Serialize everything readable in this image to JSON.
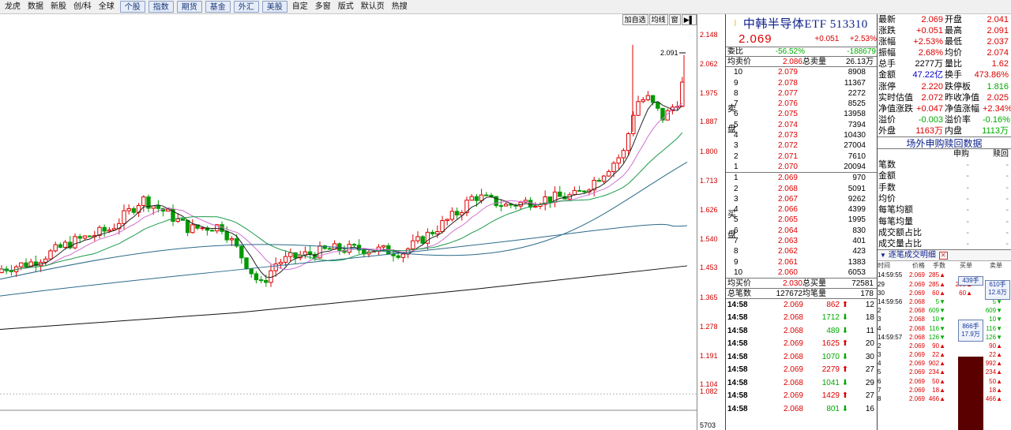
{
  "toolbar": {
    "items": [
      {
        "label": "龙虎",
        "boxed": false
      },
      {
        "label": "数据",
        "boxed": false
      },
      {
        "label": "新股",
        "boxed": false
      },
      {
        "label": "创/科",
        "boxed": false
      },
      {
        "label": "全球",
        "boxed": false
      },
      {
        "label": "个股",
        "boxed": true
      },
      {
        "label": "指数",
        "boxed": true
      },
      {
        "label": "期货",
        "boxed": true
      },
      {
        "label": "基金",
        "boxed": true
      },
      {
        "label": "外汇",
        "boxed": true
      },
      {
        "label": "美股",
        "boxed": true
      },
      {
        "label": "自定",
        "boxed": false
      },
      {
        "label": "多窗",
        "boxed": false
      },
      {
        "label": "版式",
        "boxed": false
      },
      {
        "label": "默认页",
        "boxed": false
      },
      {
        "label": "热搜",
        "boxed": false
      }
    ]
  },
  "chart": {
    "buttons": [
      "加自选",
      "均线",
      "窗",
      "▶▌"
    ],
    "price_marker": "2.091",
    "y_labels": [
      "2.148",
      "2.062",
      "1.975",
      "1.887",
      "1.800",
      "1.713",
      "1.626",
      "1.540",
      "1.453",
      "1.365",
      "1.278",
      "1.191",
      "1.104",
      "1.082",
      "5703"
    ],
    "colors": {
      "up": "#dd0000",
      "down": "#009900",
      "ma5": "#222222",
      "ma10": "#d070d0",
      "ma20": "#1a9a4a",
      "ma60": "#2a6a8a",
      "ma120": "#111111"
    }
  },
  "quote": {
    "name": "中韩半导体ETF 513310",
    "price": "2.069",
    "change": "+0.051",
    "change_pct": "+2.53%",
    "weibi_label": "委比",
    "weibi_pct": "-56.52%",
    "weibi_diff": "-188679",
    "avg_sell_label": "均卖价",
    "avg_sell": "2.086",
    "total_sell_label": "总卖量",
    "total_sell": "26.13万",
    "sell_side_label": "卖盘",
    "buy_side_label": "买盘",
    "asks": [
      {
        "n": "10",
        "price": "2.079",
        "vol": "8908"
      },
      {
        "n": "9",
        "price": "2.078",
        "vol": "11367"
      },
      {
        "n": "8",
        "price": "2.077",
        "vol": "2272"
      },
      {
        "n": "7",
        "price": "2.076",
        "vol": "8525"
      },
      {
        "n": "6",
        "price": "2.075",
        "vol": "13958"
      },
      {
        "n": "5",
        "price": "2.074",
        "vol": "7394"
      },
      {
        "n": "4",
        "price": "2.073",
        "vol": "10430"
      },
      {
        "n": "3",
        "price": "2.072",
        "vol": "27004"
      },
      {
        "n": "2",
        "price": "2.071",
        "vol": "7610"
      },
      {
        "n": "1",
        "price": "2.070",
        "vol": "20094"
      }
    ],
    "bids": [
      {
        "n": "1",
        "price": "2.069",
        "vol": "970"
      },
      {
        "n": "2",
        "price": "2.068",
        "vol": "5091"
      },
      {
        "n": "3",
        "price": "2.067",
        "vol": "9262"
      },
      {
        "n": "4",
        "price": "2.066",
        "vol": "4399"
      },
      {
        "n": "5",
        "price": "2.065",
        "vol": "1995"
      },
      {
        "n": "6",
        "price": "2.064",
        "vol": "830"
      },
      {
        "n": "7",
        "price": "2.063",
        "vol": "401"
      },
      {
        "n": "8",
        "price": "2.062",
        "vol": "423"
      },
      {
        "n": "9",
        "price": "2.061",
        "vol": "1383"
      },
      {
        "n": "10",
        "price": "2.060",
        "vol": "6053"
      }
    ],
    "avg_buy_label": "均买价",
    "avg_buy": "2.030",
    "total_buy_label": "总买量",
    "total_buy": "72581",
    "total_count_label": "总笔数",
    "total_count": "127672",
    "avg_count_label": "均笔量",
    "avg_count": "178",
    "trades": [
      {
        "time": "14:58",
        "price": "2.069",
        "vol": "862",
        "dir": "up",
        "n": "12"
      },
      {
        "time": "14:58",
        "price": "2.068",
        "vol": "1712",
        "dir": "down",
        "n": "18"
      },
      {
        "time": "14:58",
        "price": "2.068",
        "vol": "489",
        "dir": "down",
        "n": "11"
      },
      {
        "time": "14:58",
        "price": "2.069",
        "vol": "1625",
        "dir": "up",
        "n": "20"
      },
      {
        "time": "14:58",
        "price": "2.068",
        "vol": "1070",
        "dir": "down",
        "n": "30"
      },
      {
        "time": "14:58",
        "price": "2.069",
        "vol": "2279",
        "dir": "up",
        "n": "27"
      },
      {
        "time": "14:58",
        "price": "2.068",
        "vol": "1041",
        "dir": "down",
        "n": "29"
      },
      {
        "time": "14:58",
        "price": "2.069",
        "vol": "1429",
        "dir": "up",
        "n": "27"
      },
      {
        "time": "14:58",
        "price": "2.068",
        "vol": "801",
        "dir": "down",
        "n": "16"
      }
    ]
  },
  "stats": {
    "rows": [
      {
        "k1": "最新",
        "v1": "2.069",
        "k2": "开盘",
        "v2": "2.041",
        "c1": "red",
        "c2": "red"
      },
      {
        "k1": "涨跌",
        "v1": "+0.051",
        "k2": "最高",
        "v2": "2.091",
        "c1": "red",
        "c2": "red"
      },
      {
        "k1": "涨幅",
        "v1": "+2.53%",
        "k2": "最低",
        "v2": "2.037",
        "c1": "red",
        "c2": "red"
      },
      {
        "k1": "振幅",
        "v1": "2.68%",
        "k2": "均价",
        "v2": "2.074",
        "c1": "red",
        "c2": "red"
      },
      {
        "k1": "总手",
        "v1": "2277万",
        "k2": "量比",
        "v2": "1.62",
        "c1": "black",
        "c2": "red"
      },
      {
        "k1": "金额",
        "v1": "47.22亿",
        "k2": "换手",
        "v2": "473.86%",
        "c1": "blue",
        "c2": "red"
      },
      {
        "k1": "涨停",
        "v1": "2.220",
        "k2": "跌停板",
        "v2": "1.816",
        "c1": "red",
        "c2": "green"
      },
      {
        "k1": "实时估值",
        "v1": "2.072",
        "k2": "昨收净值",
        "v2": "2.025",
        "c1": "red",
        "c2": "red"
      },
      {
        "k1": "净值涨跌",
        "v1": "+0.047",
        "k2": "净值涨幅",
        "v2": "+2.34%",
        "c1": "red",
        "c2": "red"
      },
      {
        "k1": "溢价",
        "v1": "-0.003",
        "k2": "溢价率",
        "v2": "-0.16%",
        "c1": "green",
        "c2": "green"
      },
      {
        "k1": "外盘",
        "v1": "1163万",
        "k2": "内盘",
        "v2": "1113万",
        "c1": "red",
        "c2": "green"
      }
    ],
    "offmarket_title": "场外申购赎回数据",
    "sub_buy": "申购",
    "sub_sell": "赎回",
    "offmarket_rows": [
      {
        "k": "笔数",
        "a": "-",
        "b": "-"
      },
      {
        "k": "金额",
        "a": "-",
        "b": "-"
      },
      {
        "k": "手数",
        "a": "-",
        "b": "-"
      },
      {
        "k": "均价",
        "a": "-",
        "b": "-"
      },
      {
        "k": "每笔均额",
        "a": "-",
        "b": "-"
      },
      {
        "k": "每笔均量",
        "a": "-",
        "b": "-"
      },
      {
        "k": "成交额占比",
        "a": "-",
        "b": "-"
      },
      {
        "k": "成交量占比",
        "a": "-",
        "b": "-"
      }
    ],
    "detail_title": "逐笔成交明细",
    "detail_headers": [
      "时间",
      "价格",
      "手数",
      "买单",
      "卖单"
    ],
    "detail_rows": [
      {
        "t": "14:59:55",
        "p": "2.069",
        "q": "285▲",
        "buy": "",
        "sell": ""
      },
      {
        "t": "29",
        "p": "2.069",
        "q": "285▲",
        "buy": "285▲",
        "sell": ""
      },
      {
        "t": "30",
        "p": "2.069",
        "q": "60▲",
        "buy": "60▲",
        "sell": ""
      },
      {
        "t": "14:59:56",
        "p": "2.068",
        "q": "5▼",
        "buy": "",
        "sell": "5▼"
      },
      {
        "t": "2",
        "p": "2.068",
        "q": "609▼",
        "buy": "",
        "sell": "609▼"
      },
      {
        "t": "3",
        "p": "2.068",
        "q": "10▼",
        "buy": "",
        "sell": "10▼"
      },
      {
        "t": "4",
        "p": "2.068",
        "q": "116▼",
        "buy": "",
        "sell": "116▼"
      },
      {
        "t": "14:59:57",
        "p": "2.068",
        "q": "126▼",
        "buy": "",
        "sell": "126▼"
      },
      {
        "t": "2",
        "p": "2.069",
        "q": "90▲",
        "buy": "",
        "sell": "90▲"
      },
      {
        "t": "3",
        "p": "2.069",
        "q": "22▲",
        "buy": "",
        "sell": "22▲"
      },
      {
        "t": "4",
        "p": "2.069",
        "q": "902▲",
        "buy": "",
        "sell": "992▲"
      },
      {
        "t": "5",
        "p": "2.069",
        "q": "234▲",
        "buy": "",
        "sell": "234▲"
      },
      {
        "t": "6",
        "p": "2.069",
        "q": "50▲",
        "buy": "",
        "sell": "50▲"
      },
      {
        "t": "7",
        "p": "2.069",
        "q": "18▲",
        "buy": "",
        "sell": "18▲"
      },
      {
        "t": "8",
        "p": "2.069",
        "q": "466▲",
        "buy": "",
        "sell": "466▲"
      }
    ],
    "box1_a": "439手",
    "box2_a": "610手",
    "box2_b": "12.6万",
    "box3_a": "866手",
    "box3_b": "17.9万"
  }
}
